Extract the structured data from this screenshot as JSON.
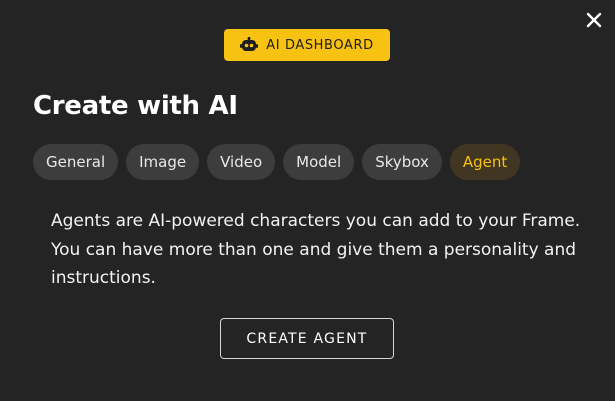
{
  "modal": {
    "title": "Create with AI",
    "close_icon": "close-icon",
    "dashboard_button": {
      "label": "AI DASHBOARD",
      "icon": "robot-icon",
      "background": "#f7c212"
    },
    "tabs": [
      {
        "label": "General",
        "active": false
      },
      {
        "label": "Image",
        "active": false
      },
      {
        "label": "Video",
        "active": false
      },
      {
        "label": "Model",
        "active": false
      },
      {
        "label": "Skybox",
        "active": false
      },
      {
        "label": "Agent",
        "active": true
      }
    ],
    "description": "Agents are AI-powered characters you can add to your Frame. You can have more than one and give them a personality and instructions.",
    "primary_action_label": "CREATE AGENT"
  },
  "colors": {
    "background": "#242424",
    "accent": "#f7c212",
    "tab_background": "#3d3d3d",
    "active_tab_background": "#403621"
  }
}
